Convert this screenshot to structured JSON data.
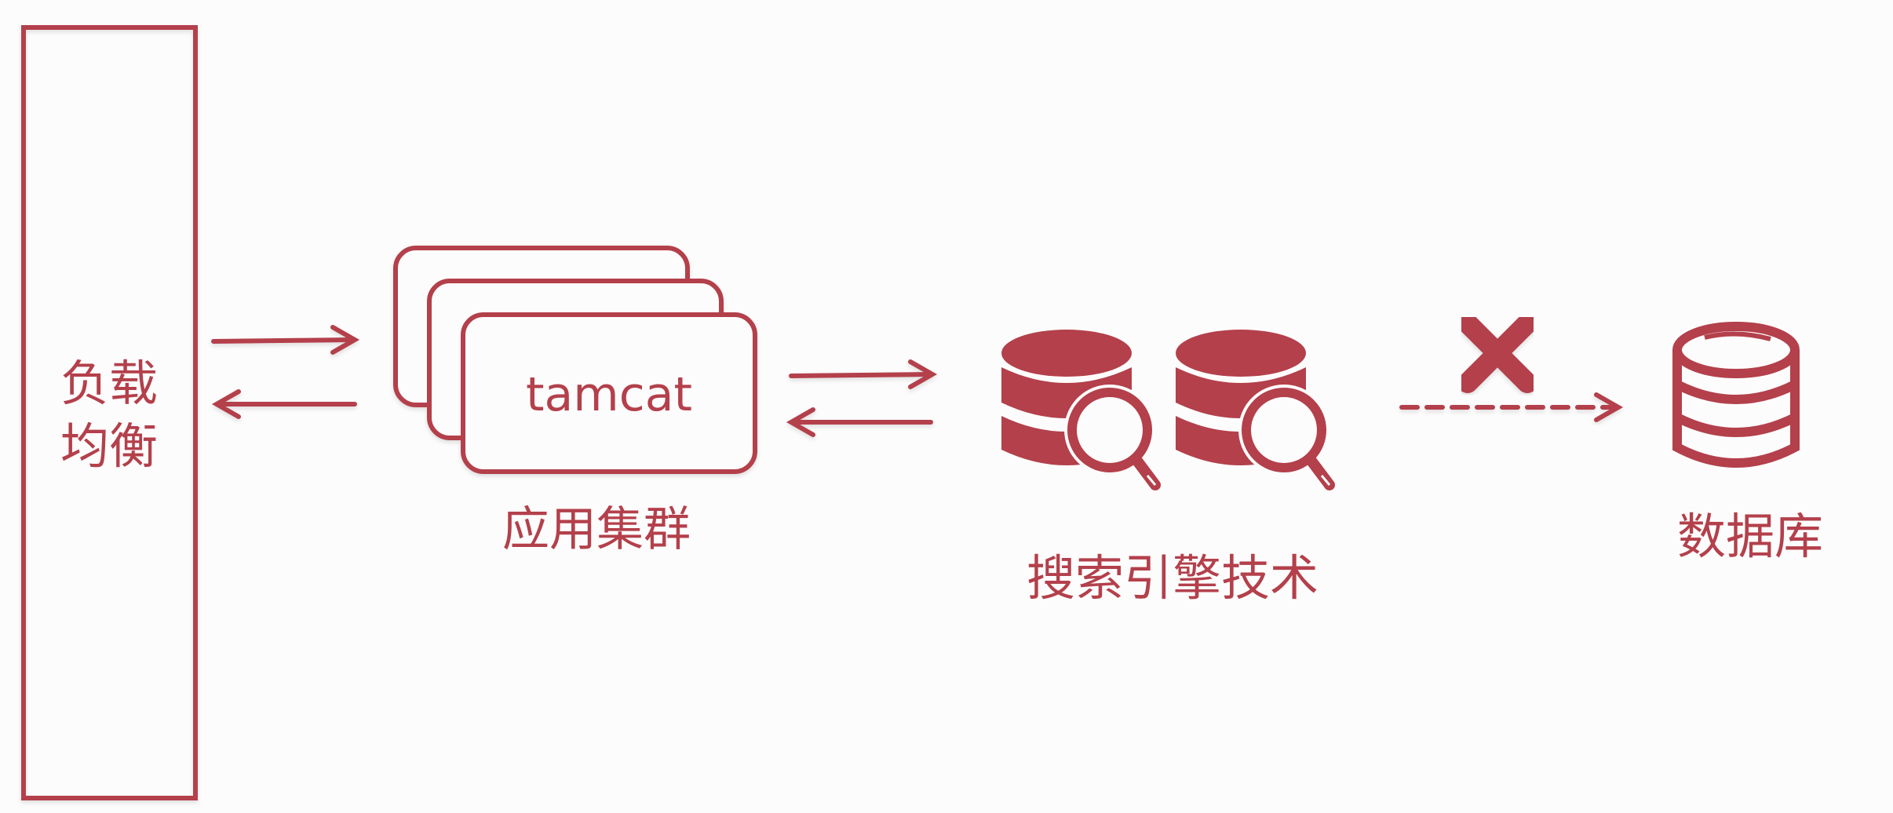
{
  "colors": {
    "accent": "#b3404b",
    "background": "#fdfcfc"
  },
  "nodes": {
    "load_balancer": {
      "label_line1": "负载",
      "label_line2": "均衡"
    },
    "app_cluster": {
      "card_text": "tamcat",
      "label": "应用集群",
      "card_count": 3
    },
    "search_engine": {
      "label": "搜索引擎技术",
      "icon": "database-search-icon",
      "icon_count": 2
    },
    "database": {
      "label": "数据库",
      "icon": "database-icon"
    }
  },
  "edges": [
    {
      "from": "load_balancer",
      "to": "app_cluster",
      "style": "solid",
      "direction": "both"
    },
    {
      "from": "app_cluster",
      "to": "search_engine",
      "style": "solid",
      "direction": "both"
    },
    {
      "from": "search_engine",
      "to": "database",
      "style": "dashed",
      "direction": "forward",
      "blocked": true,
      "marker": "cross-icon"
    }
  ]
}
